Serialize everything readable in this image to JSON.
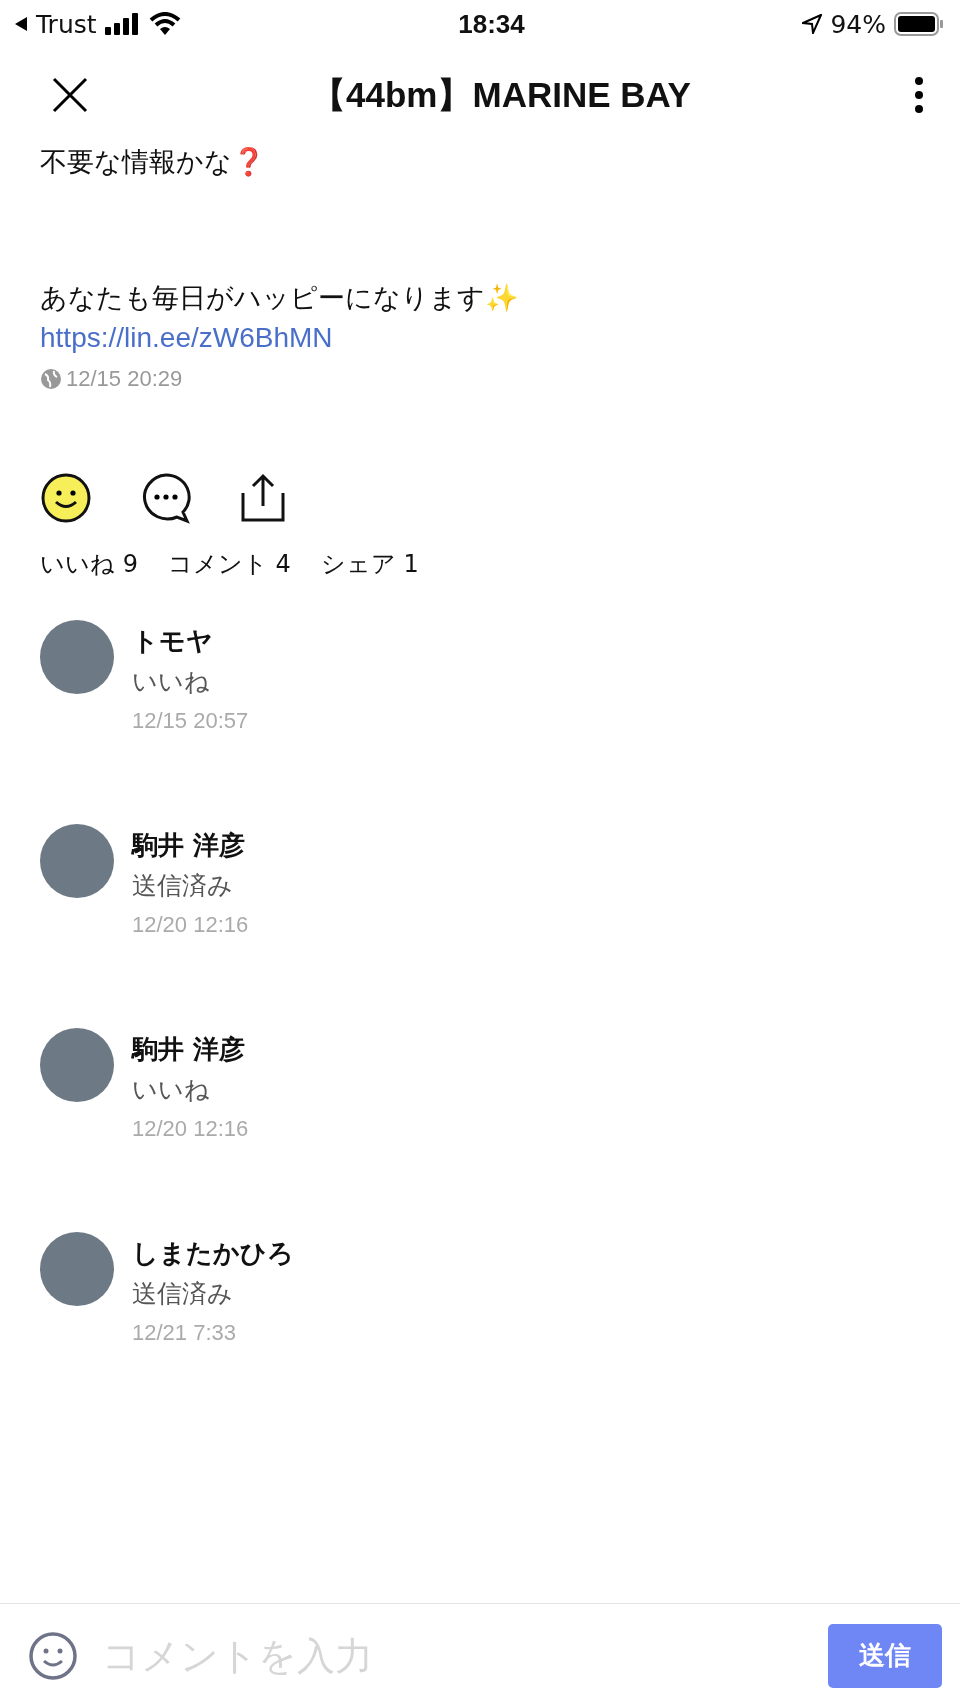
{
  "status_bar": {
    "back_app": "Trust",
    "time": "18:34",
    "battery": "94%"
  },
  "header": {
    "title": "【44bm】MARINE BAY"
  },
  "post": {
    "paragraphs": [
      "不要な情報かな❓",
      "あなたも毎日がハッピーになります✨"
    ],
    "link": "https://lin.ee/zW6BhMN",
    "timestamp": "12/15 20:29"
  },
  "actions": {
    "liked": true
  },
  "counts": [
    "いいね 9",
    "コメント 4",
    "シェア 1"
  ],
  "comments": [
    {
      "name": "トモヤ",
      "text": "いいね",
      "time": "12/15 20:57"
    },
    {
      "name": "駒井 洋彦",
      "text": "送信済み",
      "time": "12/20 12:16"
    },
    {
      "name": "駒井 洋彦",
      "text": "いいね",
      "time": "12/20 12:16"
    },
    {
      "name": "しまたかひろ",
      "text": "送信済み",
      "time": "12/21 7:33"
    }
  ],
  "composer": {
    "placeholder": "コメントを入力",
    "send": "送信"
  }
}
